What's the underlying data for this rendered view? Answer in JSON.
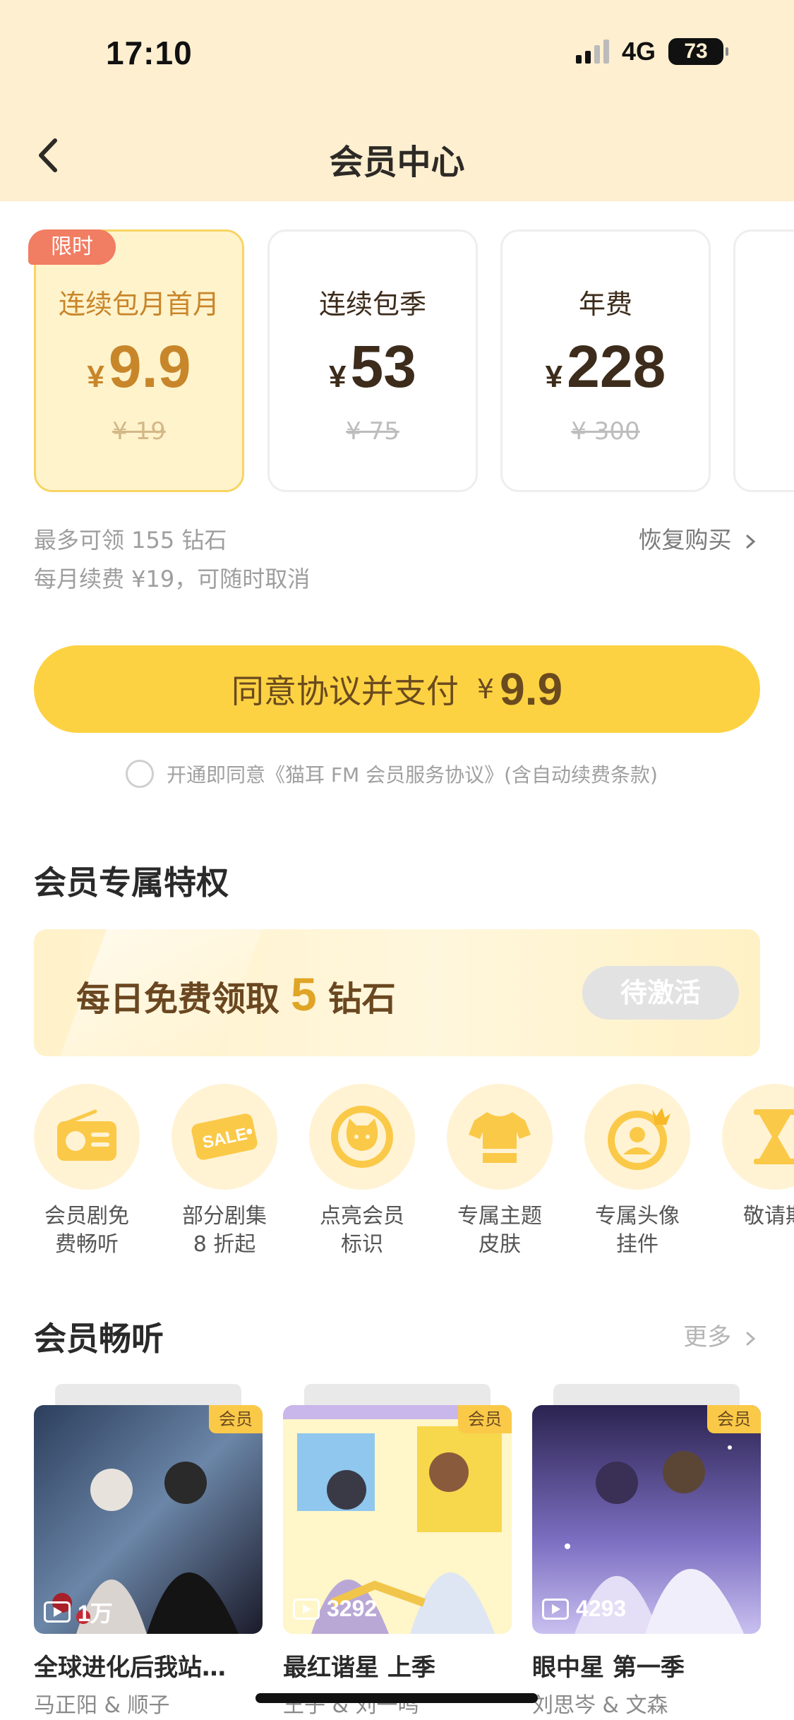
{
  "status_bar": {
    "time": "17:10",
    "network": "4G",
    "battery": "73"
  },
  "header": {
    "title": "会员中心"
  },
  "plans": {
    "limited_badge": "限时",
    "items": [
      {
        "name": "连续包月首月",
        "currency": "¥",
        "price": "9.9",
        "original": "¥ 19",
        "selected": true
      },
      {
        "name": "连续包季",
        "currency": "¥",
        "price": "53",
        "original": "¥ 75",
        "selected": false
      },
      {
        "name": "年费",
        "currency": "¥",
        "price": "228",
        "original": "¥ 300",
        "selected": false
      }
    ]
  },
  "info": {
    "diamonds_line": "最多可领 155 钻石",
    "renew_line": "每月续费 ¥19，可随时取消",
    "restore": "恢复购买"
  },
  "pay": {
    "label": "同意协议并支付",
    "currency": "¥",
    "amount": "9.9"
  },
  "agreement": {
    "text": "开通即同意《猫耳 FM 会员服务协议》(含自动续费条款)"
  },
  "privileges_section": {
    "title": "会员专属特权",
    "banner": {
      "prefix": "每日免费领取",
      "number": "5",
      "suffix": "钻石",
      "status": "待激活"
    },
    "items": [
      {
        "label_line1": "会员剧免",
        "label_line2": "费畅听",
        "icon": "radio-icon"
      },
      {
        "label_line1": "部分剧集",
        "label_line2": "8 折起",
        "icon": "sale-tag-icon"
      },
      {
        "label_line1": "点亮会员",
        "label_line2": "标识",
        "icon": "cat-badge-icon"
      },
      {
        "label_line1": "专属主题",
        "label_line2": "皮肤",
        "icon": "tshirt-icon"
      },
      {
        "label_line1": "专属头像",
        "label_line2": "挂件",
        "icon": "avatar-crown-icon"
      },
      {
        "label_line1": "敬请期",
        "label_line2": "",
        "icon": "hourglass-icon"
      }
    ]
  },
  "listen_section": {
    "title": "会员畅听",
    "more": "更多",
    "vip_badge": "会员",
    "items": [
      {
        "plays": "1万",
        "title": "全球进化后我站…",
        "authors": "马正阳 & 顺子"
      },
      {
        "plays": "3292",
        "title": "最红谐星 上季",
        "authors": "王子 & 刘一鸣"
      },
      {
        "plays": "4293",
        "title": "眼中星 第一季",
        "authors": "刘思岑 & 文森"
      }
    ]
  },
  "colors": {
    "accent": "#fdd242",
    "header_bg": "#fdefd0",
    "selected_text": "#c8862a",
    "limited_badge": "#f17d63"
  }
}
